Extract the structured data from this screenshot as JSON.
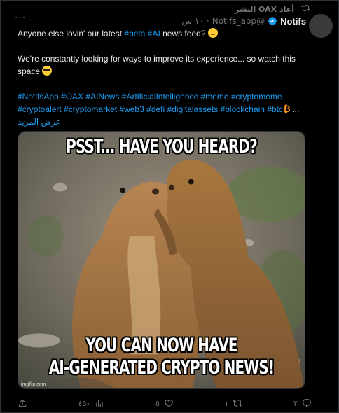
{
  "repost": {
    "label": "أعاد OAX النشر",
    "icon": "repost-icon"
  },
  "author": {
    "name": "Notifs",
    "handle": "@Notifs_app",
    "separator": "·",
    "time": "١٠ س",
    "verified_icon": "verified-badge-icon"
  },
  "more_label": "···",
  "tweet": {
    "line1_text": "Anyone else lovin' our latest ",
    "line1_tag1": "#beta",
    "line1_tag2": "#AI",
    "line1_end": " news feed? ",
    "line2": "We're constantly looking for ways to improve its experience... so watch this space ",
    "hashtags": [
      "#NotifsApp",
      "#OAX",
      "#AINews",
      "#ArtificialIntelligence",
      "#meme",
      "#cryptomeme",
      "#cryptoalert",
      "#cryptomarket",
      "#web3",
      "#defi",
      "#digitalassets",
      "#blockchain",
      "#btc"
    ],
    "ellipsis": "...",
    "show_more": "عرض المزيد"
  },
  "media": {
    "top_text": "PSST... HAVE YOU HEARD?",
    "bottom_line1": "YOU CAN NOW HAVE",
    "bottom_line2": "AI-GENERATED CRYPTO NEWS!",
    "watermark": "imgflip.com"
  },
  "actions": {
    "reply_count": "٢",
    "repost_count": "١",
    "like_count": "٥",
    "views_count": "٤٥٠"
  },
  "colors": {
    "accent": "#1d9bf0",
    "muted": "#71767b",
    "text": "#e7e9ea",
    "background": "#000000"
  }
}
